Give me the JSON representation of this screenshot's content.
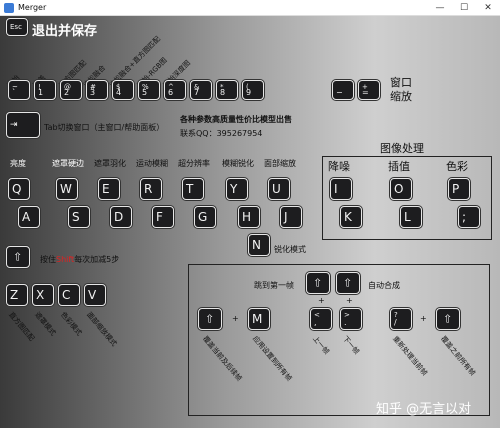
{
  "window": {
    "title": "Merger",
    "min": "—",
    "max": "☐",
    "close": "✕"
  },
  "esc": {
    "key": "Esc",
    "label": "退出并保存"
  },
  "num_row": [
    {
      "top": "~",
      "main": "`"
    },
    {
      "top": "!",
      "main": "1"
    },
    {
      "top": "@",
      "main": "2"
    },
    {
      "top": "#",
      "main": "3"
    },
    {
      "top": "$",
      "main": "4"
    },
    {
      "top": "%",
      "main": "5"
    },
    {
      "top": "^",
      "main": "6"
    },
    {
      "top": "&",
      "main": "7"
    },
    {
      "top": "*",
      "main": "8"
    },
    {
      "top": "(",
      "main": "9"
    }
  ],
  "num_labels": [
    "原始",
    "覆盖",
    "直方图匹配",
    "泊松融合",
    "泊松融合+直方图匹配",
    "原始-RGB图",
    "原始深度图"
  ],
  "zoom_keys": [
    {
      "top": "",
      "main": "−"
    },
    {
      "top": "+",
      "main": "="
    }
  ],
  "zoom_label_1": "窗口",
  "zoom_label_2": "缩放",
  "tab_label": "Tab切换窗口（主窗口/帮助面板）",
  "promo_1": "各种参数高质量性价比模型出售",
  "promo_2": "联系QQ：395267954",
  "row_labels": [
    "亮度",
    "遮罩硬边",
    "遮罩羽化",
    "运动模糊",
    "超分辨率",
    "模糊锐化",
    "面部缩放"
  ],
  "qrow": [
    "Q",
    "W",
    "E",
    "R",
    "T",
    "Y",
    "U"
  ],
  "arow": [
    "A",
    "S",
    "D",
    "F",
    "G",
    "H",
    "J"
  ],
  "image_proc": {
    "title": "图像处理",
    "cols": [
      "降噪",
      "插值",
      "色彩"
    ],
    "top_keys": [
      "I",
      "O",
      "P"
    ],
    "bottom_keys": [
      "K",
      "L",
      ";"
    ]
  },
  "n_key": {
    "main": "N",
    "label": "锐化模式"
  },
  "shift_label_pre": "按住",
  "shift_label_word": "Shift",
  "shift_label_post": "每次加减5步",
  "zrow": [
    "Z",
    "X",
    "C",
    "V"
  ],
  "zrow_labels": [
    "直方图匹配",
    "遮罩模式",
    "色彩模式",
    "面部缩放模式"
  ],
  "nav": {
    "jump_first": "跳到第一帧",
    "auto_merge": "自动合成",
    "plus": "+",
    "m_key": "M",
    "comma_key": {
      "top": "<",
      "main": ","
    },
    "period_key": {
      "top": ">",
      "main": "."
    },
    "slash_key": {
      "top": "?",
      "main": "/"
    },
    "labels": [
      "覆盖当前及后续帧",
      "应用设置到所有帧",
      "上一帧",
      "下一帧",
      "重新处理当前帧",
      "覆盖之前所有帧"
    ]
  },
  "watermark": "知乎 @无言以对"
}
